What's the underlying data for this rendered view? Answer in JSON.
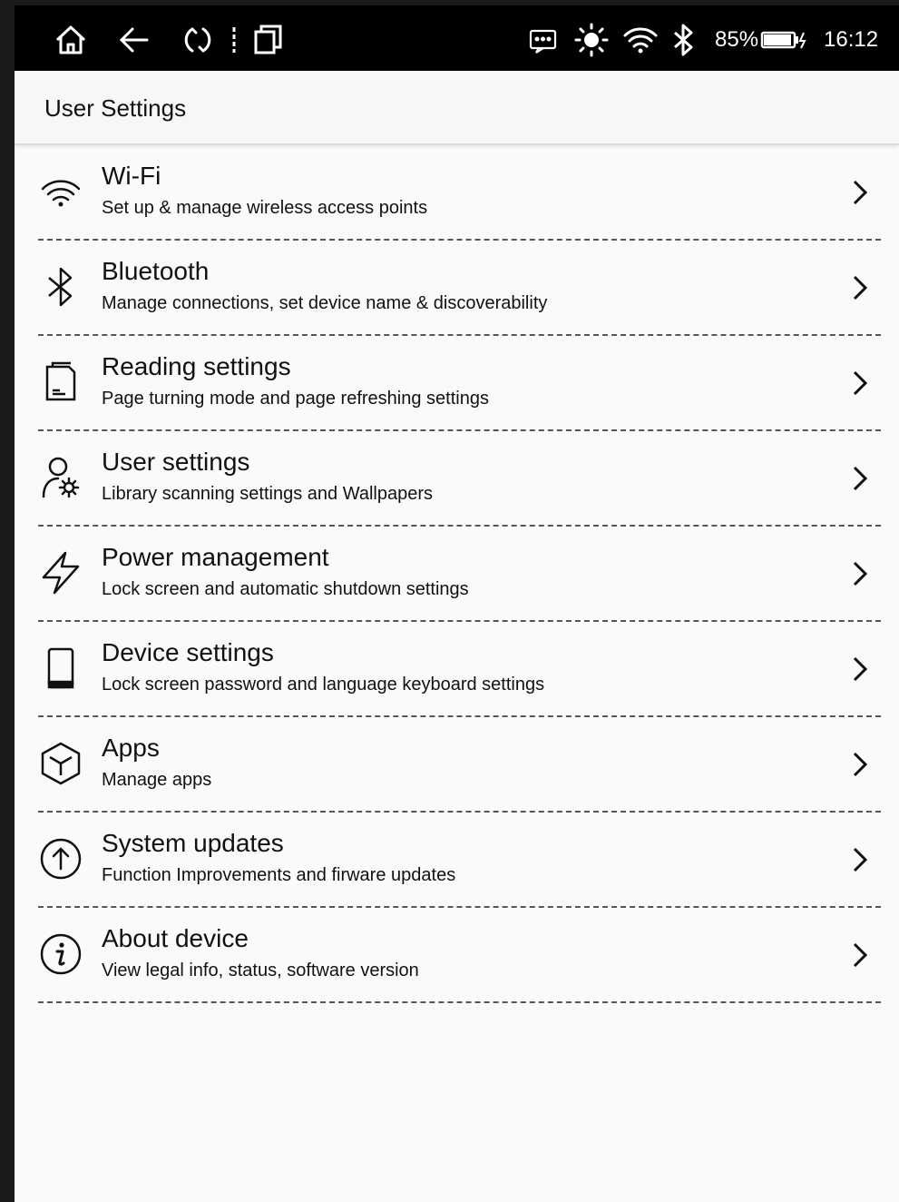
{
  "status_bar": {
    "battery": "85%",
    "time": "16:12"
  },
  "header": {
    "title": "User Settings"
  },
  "items": [
    {
      "title": "Wi-Fi",
      "subtitle": "Set up & manage wireless access points",
      "icon": "wifi-icon"
    },
    {
      "title": "Bluetooth",
      "subtitle": "Manage connections, set device name & discoverability",
      "icon": "bluetooth-icon"
    },
    {
      "title": "Reading settings",
      "subtitle": "Page turning mode and page refreshing settings",
      "icon": "document-icon"
    },
    {
      "title": "User settings",
      "subtitle": "Library scanning settings and Wallpapers",
      "icon": "user-gear-icon"
    },
    {
      "title": "Power management",
      "subtitle": "Lock screen and automatic shutdown settings",
      "icon": "lightning-icon"
    },
    {
      "title": "Device settings",
      "subtitle": "Lock screen password and language keyboard settings",
      "icon": "tablet-icon"
    },
    {
      "title": "Apps",
      "subtitle": "Manage apps",
      "icon": "cube-icon"
    },
    {
      "title": "System updates",
      "subtitle": "Function Improvements and firware updates",
      "icon": "arrow-up-circle-icon"
    },
    {
      "title": "About device",
      "subtitle": "View legal info, status, software version",
      "icon": "info-circle-icon"
    }
  ]
}
